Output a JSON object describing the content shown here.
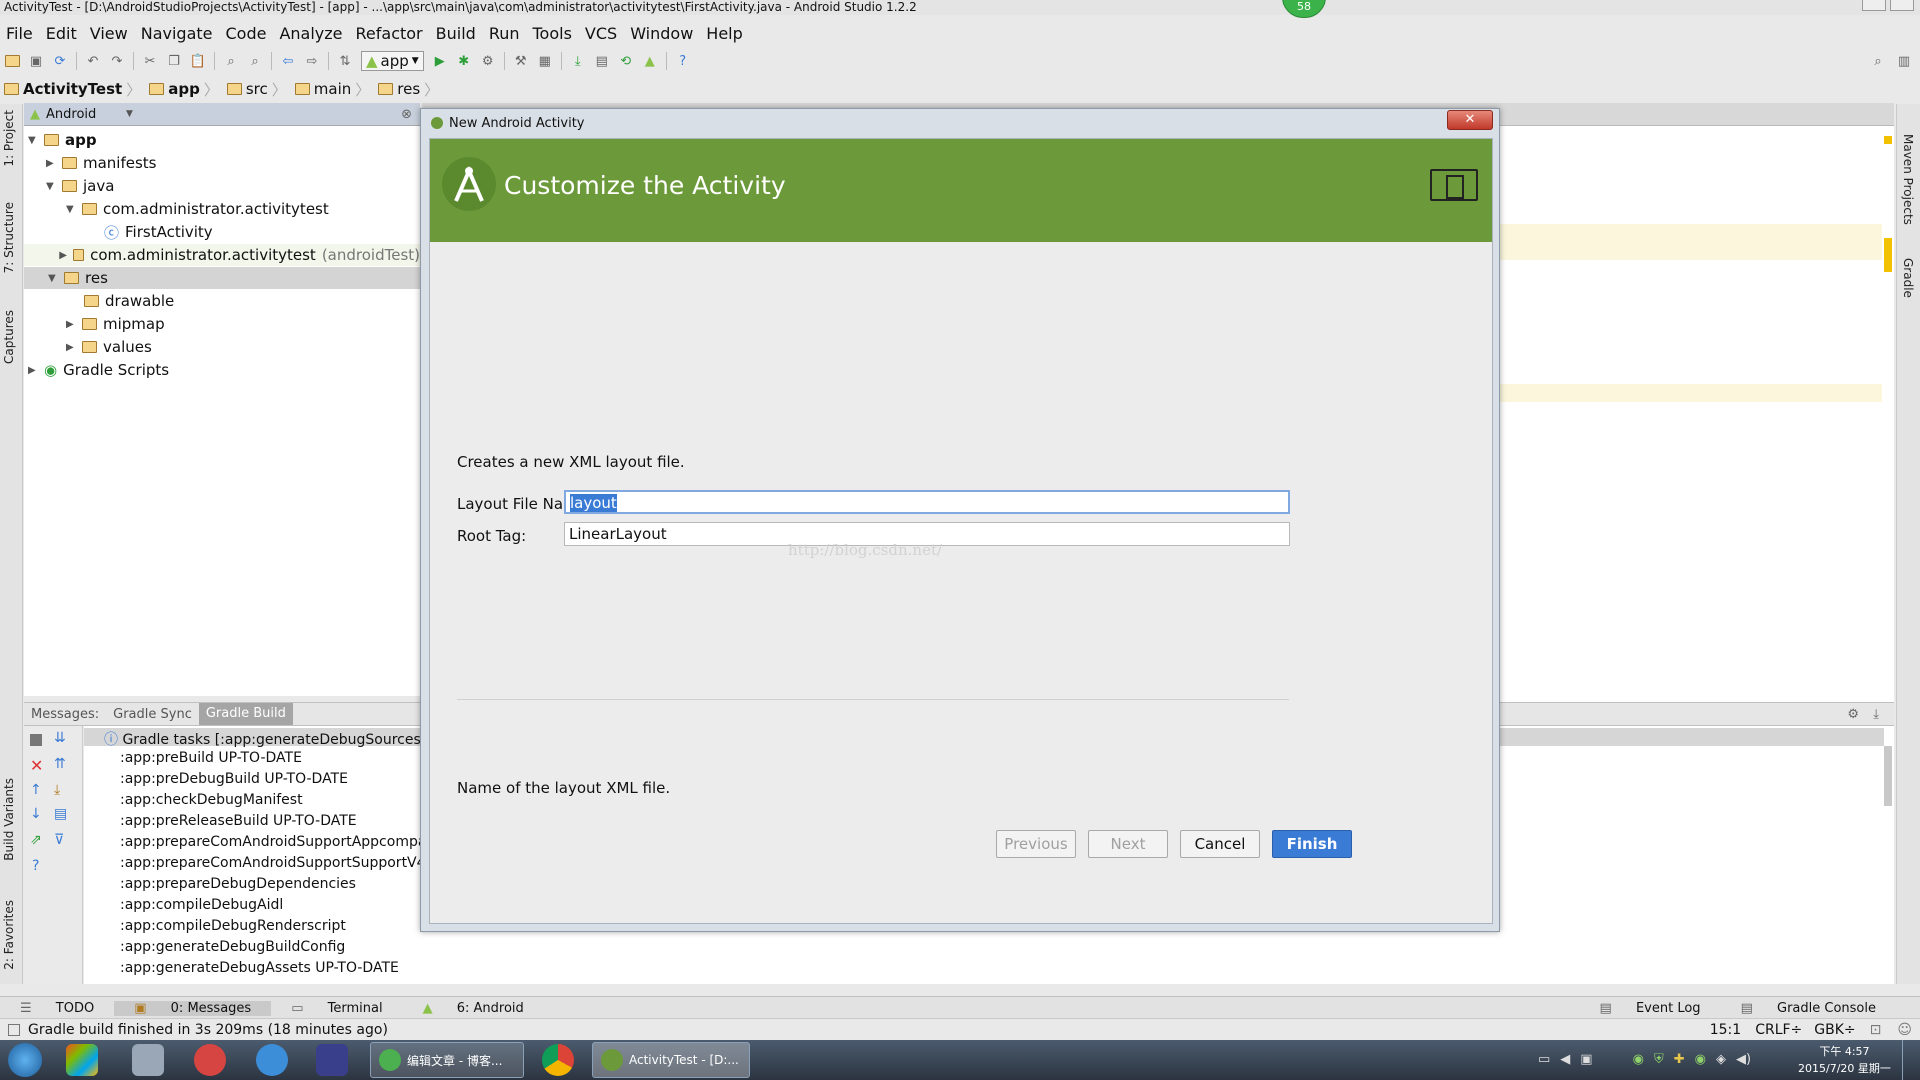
{
  "window": {
    "title": "ActivityTest - [D:\\AndroidStudioProjects\\ActivityTest] - [app] - ...\\app\\src\\main\\java\\com\\administrator\\activitytest\\FirstActivity.java - Android Studio 1.2.2",
    "badge": "58"
  },
  "menu": [
    "File",
    "Edit",
    "View",
    "Navigate",
    "Code",
    "Analyze",
    "Refactor",
    "Build",
    "Run",
    "Tools",
    "VCS",
    "Window",
    "Help"
  ],
  "toolbar": {
    "run_config": "app"
  },
  "breadcrumb": [
    "ActivityTest",
    "app",
    "src",
    "main",
    "res"
  ],
  "left_tool_tabs": [
    "1: Project",
    "7: Structure",
    "Captures",
    "Build Variants",
    "2: Favorites"
  ],
  "right_tool_tabs": [
    "Maven Projects",
    "Gradle"
  ],
  "project": {
    "view_mode": "Android",
    "tree": [
      {
        "label": "app"
      },
      {
        "label": "manifests"
      },
      {
        "label": "java"
      },
      {
        "label": "com.administrator.activitytest"
      },
      {
        "label": "FirstActivity"
      },
      {
        "label": "com.administrator.activitytest",
        "suffix": "(androidTest)"
      },
      {
        "label": "res"
      },
      {
        "label": "drawable"
      },
      {
        "label": "mipmap"
      },
      {
        "label": "values"
      },
      {
        "label": "Gradle Scripts"
      }
    ]
  },
  "messages": {
    "tabs": [
      "Messages:",
      "Gradle Sync",
      "Gradle Build"
    ],
    "header": "Gradle tasks [:app:generateDebugSources, :a",
    "lines": [
      ":app:preBuild UP-TO-DATE",
      ":app:preDebugBuild UP-TO-DATE",
      ":app:checkDebugManifest",
      ":app:preReleaseBuild UP-TO-DATE",
      ":app:prepareComAndroidSupportAppcompa",
      ":app:prepareComAndroidSupportSupportV4",
      ":app:prepareDebugDependencies",
      ":app:compileDebugAidl",
      ":app:compileDebugRenderscript",
      ":app:generateDebugBuildConfig",
      ":app:generateDebugAssets UP-TO-DATE"
    ]
  },
  "bottom_tabs": {
    "left": [
      "TODO",
      "0: Messages",
      "Terminal",
      "6: Android"
    ],
    "right": [
      "Event Log",
      "Gradle Console"
    ]
  },
  "status": {
    "message": "Gradle build finished in 3s 209ms (18 minutes ago)",
    "position": "15:1",
    "line_sep": "CRLF÷",
    "encoding": "GBK÷"
  },
  "dialog": {
    "window_title": "New Android Activity",
    "heading": "Customize the Activity",
    "description": "Creates a new XML layout file.",
    "layout_label": "Layout File Name:",
    "layout_value": "layout",
    "root_label": "Root Tag:",
    "root_value": "LinearLayout",
    "watermark": "http://blog.csdn.net/",
    "hint": "Name of the layout XML file.",
    "buttons": {
      "previous": "Previous",
      "next": "Next",
      "cancel": "Cancel",
      "finish": "Finish"
    }
  },
  "taskbar": {
    "tasks": [
      "编辑文章 - 博客...",
      "ActivityTest - [D:..."
    ],
    "clock_time": "下午 4:57",
    "clock_date": "2015/7/20 星期一"
  },
  "colors": {
    "banner": "#6c9a3a",
    "finish": "#3a7bd5",
    "android_green": "#8bc34a"
  }
}
